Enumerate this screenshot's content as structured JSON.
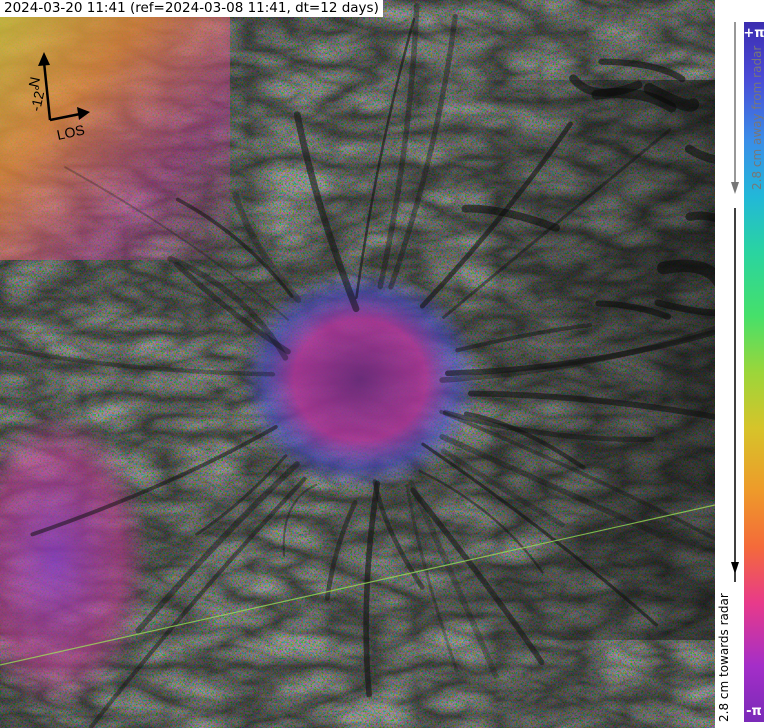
{
  "title": "2024-03-20 11:41 (ref=2024-03-08 11:41, dt=12 days)",
  "compass": {
    "angle_label": "-12°",
    "north_label": "N",
    "los_label": "LOS",
    "north_icon": "north-arrow-icon",
    "los_icon": "los-arrow-icon"
  },
  "colorbar": {
    "top_label": "+π",
    "bottom_label": "-π",
    "away_label": "2.8 cm away from radar",
    "towards_label": "2.8 cm towards radar",
    "colors": [
      "#3b2db0",
      "#4a4ad6",
      "#3a8ee8",
      "#22b8d8",
      "#2ad4a0",
      "#46e06a",
      "#9bd63a",
      "#d6c42a",
      "#ee9a2a",
      "#f46a3a",
      "#e83a8a",
      "#a42ec8",
      "#7a2ab8"
    ]
  },
  "map": {
    "background_color": "#3a3a3a",
    "fringe_colors": [
      "#e83a8a",
      "#a42ec8",
      "#4a4ad6",
      "#22b8d8",
      "#46e06a",
      "#d6c42a",
      "#f46a3a"
    ],
    "feature_line_color": "#9ee35a"
  }
}
